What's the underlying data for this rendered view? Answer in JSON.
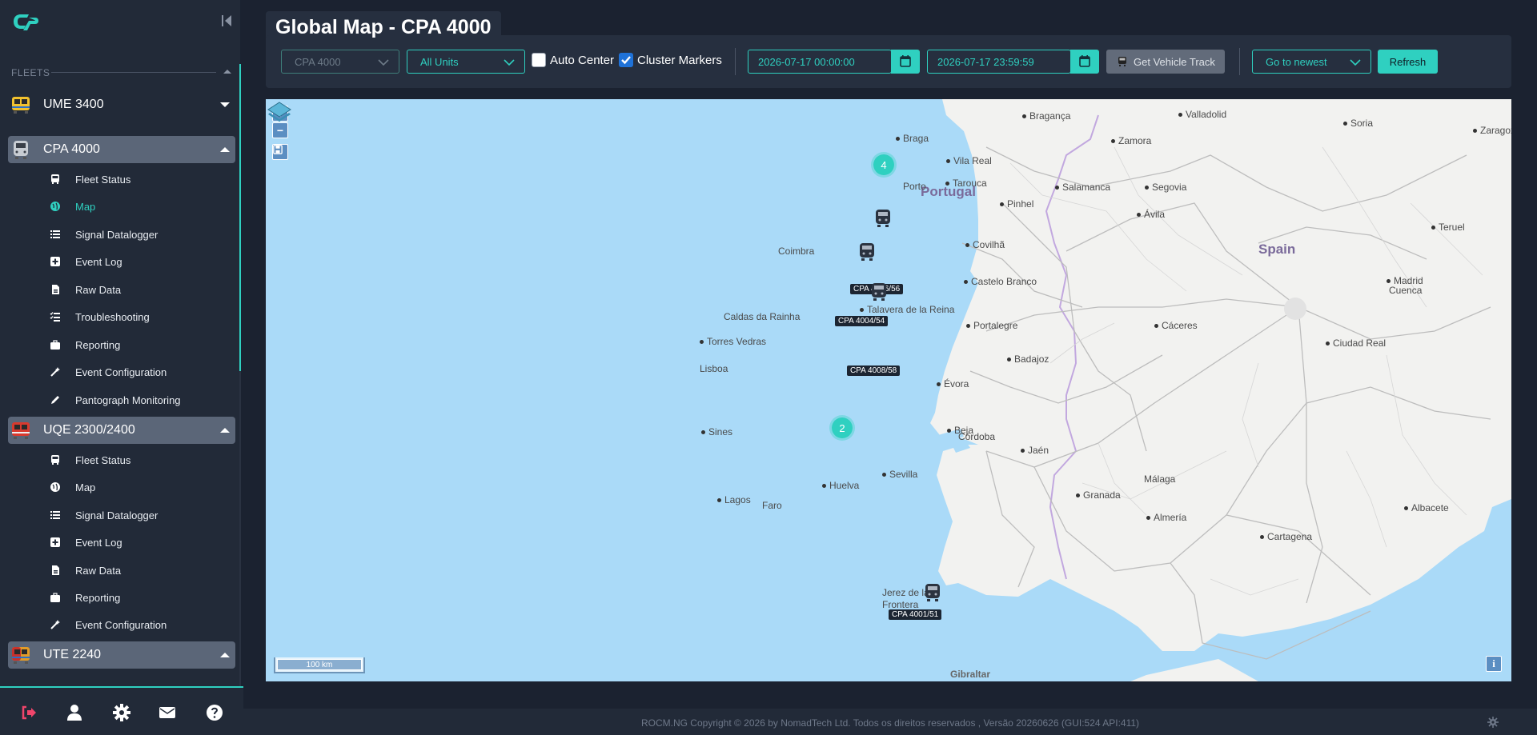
{
  "sidebar": {
    "fleets_label": "FLEETS",
    "fleets": [
      {
        "name": "UME 3400",
        "expanded": false,
        "active": false
      },
      {
        "name": "CPA 4000",
        "expanded": true,
        "active": true,
        "items": [
          "Fleet Status",
          "Map",
          "Signal Datalogger",
          "Event Log",
          "Raw Data",
          "Troubleshooting",
          "Reporting",
          "Event Configuration",
          "Pantograph Monitoring"
        ],
        "current": "Map"
      },
      {
        "name": "UQE 2300/2400",
        "expanded": true,
        "active": true,
        "items": [
          "Fleet Status",
          "Map",
          "Signal Datalogger",
          "Event Log",
          "Raw Data",
          "Reporting",
          "Event Configuration"
        ]
      },
      {
        "name": "UTE 2240",
        "expanded": false,
        "active": true
      }
    ]
  },
  "header": {
    "title": "Global Map - CPA 4000"
  },
  "toolbar": {
    "fleet_select": "CPA 4000",
    "units_select": "All Units",
    "auto_center_label": "Auto Center",
    "auto_center_checked": false,
    "cluster_markers_label": "Cluster Markers",
    "cluster_markers_checked": true,
    "date_from": "2026-07-17 00:00:00",
    "date_to": "2026-07-17 23:59:59",
    "get_track_label": "Get Vehicle Track",
    "goto_select": "Go to newest",
    "refresh_label": "Refresh"
  },
  "map": {
    "zoom_in": "+",
    "zoom_out": "−",
    "scale": "100 km",
    "info": "i",
    "countries": [
      "Portugal",
      "Spain"
    ],
    "places": [
      "Bragança",
      "Braga",
      "Vila Real",
      "Porto",
      "Tarouca",
      "Pinhel",
      "Covilhã",
      "Coimbra",
      "Castelo Branco",
      "Caldas da Rainha",
      "Portalegre",
      "Torres Vedras",
      "Lisboa",
      "Badajoz",
      "Évora",
      "Sines",
      "Beja",
      "Lagos",
      "Faro",
      "Huelva",
      "Sevilla",
      "Córdoba",
      "Jaén",
      "Granada",
      "Málaga",
      "Almería",
      "Cartagena",
      "Albacete",
      "Ciudad Real",
      "Cáceres",
      "Madrid",
      "Talavera de la Reina",
      "Cuenca",
      "Teruel",
      "Segovia",
      "Ávila",
      "Salamanca",
      "Zamora",
      "Valladolid",
      "Soria",
      "Zaragoza",
      "Jerez de la Frontera",
      "Gibraltar"
    ],
    "clusters": [
      "4",
      "2"
    ],
    "vehicles": [
      "CPA 4006/56",
      "CPA 4004/54",
      "CPA 4008/58",
      "CPA 4001/51"
    ]
  },
  "footer": {
    "text": "ROCM.NG Copyright © 2026 by NomadTech Ltd. Todos os direitos reservados , Versão 20260626 (GUI:524 API:411)"
  },
  "colors": {
    "accent": "#2fd0c0",
    "background": "#1b2230",
    "sidebar": "#222a38",
    "active_fleet": "#5b6678",
    "sea": "#aadaf8"
  }
}
